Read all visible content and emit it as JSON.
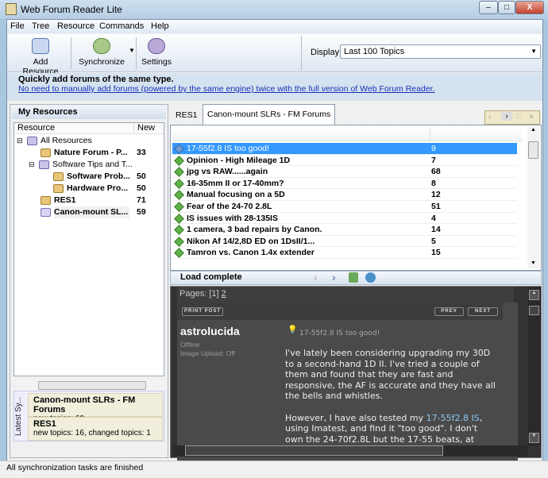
{
  "window": {
    "title": "Web Forum Reader Lite",
    "minimize": "–",
    "maximize": "□",
    "close": "X"
  },
  "menu": [
    "File",
    "Tree",
    "Resource",
    "Commands",
    "Help"
  ],
  "toolbar": {
    "add_resource": "Add Resource",
    "synchronize": "Synchronize",
    "settings": "Settings",
    "display_label": "Display:",
    "display_value": "Last 100 Topics"
  },
  "banner": {
    "title": "Quickly add forums of the same type.",
    "link": "No need to manually add forums (powered by the same engine) twice with the full version of Web Forum Reader."
  },
  "left": {
    "title": "My Resources",
    "col_resource": "Resource",
    "col_new": "New",
    "tree": [
      {
        "label": "All Resources",
        "count": ""
      },
      {
        "label": "Nature Forum - P...",
        "count": "33"
      },
      {
        "label": "Software Tips and T...",
        "count": ""
      },
      {
        "label": "Software Prob...",
        "count": "50"
      },
      {
        "label": "Hardware Pro...",
        "count": "50"
      },
      {
        "label": "RES1",
        "count": "71"
      },
      {
        "label": "Canon-mount SL...",
        "count": "59"
      }
    ],
    "sync_label": "Latest Sy...",
    "sync": [
      {
        "title": "Canon-mount SLRs - FM Forums",
        "detail": "new topics: 60"
      },
      {
        "title": "RES1",
        "detail": "new topics: 16, changed topics: 1"
      }
    ]
  },
  "tabs": [
    "RES1",
    "Canon-mount SLRs - FM Forums"
  ],
  "topics": [
    {
      "title": "17-55f2.8 IS too good!",
      "count": "9"
    },
    {
      "title": "Opinion - High Mileage 1D",
      "count": "7"
    },
    {
      "title": "jpg vs RAW......again",
      "count": "68"
    },
    {
      "title": "16-35mm II or 17-40mm?",
      "count": "8"
    },
    {
      "title": "Manual focusing on a 5D",
      "count": "12"
    },
    {
      "title": "Fear of the 24-70 2.8L",
      "count": "51"
    },
    {
      "title": "IS issues with 28-135IS",
      "count": "4"
    },
    {
      "title": "1 camera, 3 bad repairs by Canon.",
      "count": "14"
    },
    {
      "title": "Nikon Af 14/2,8D ED on 1DsII/1...",
      "count": "5"
    },
    {
      "title": "Tamron vs. Canon 1.4x extender",
      "count": "15"
    }
  ],
  "load_status": "Load complete",
  "post": {
    "pages_label": "Pages:",
    "page_current": "[1]",
    "page_other": "2",
    "print": "PRINT POST",
    "prev": "PREV",
    "next": "NEXT",
    "author": "astrolucida",
    "status": "Offline",
    "upload": "Image Upload: Off",
    "subject": "17-55f2.8 IS too good!",
    "para1": "I've lately been considering upgrading my 30D to a second-hand 1D II. I've tried a couple of them and found that they are fast and responsive, the AF is accurate and they have all the bells and whistles.",
    "para2_pre": "However, I have also tested my ",
    "para2_link": "17-55f2.8 IS",
    "para2_post": ", using Imatest, and find it \"too good\". I don't own the 24-70f2.8L but the 17-55 beats, at"
  },
  "status": "All synchronization tasks are finished"
}
